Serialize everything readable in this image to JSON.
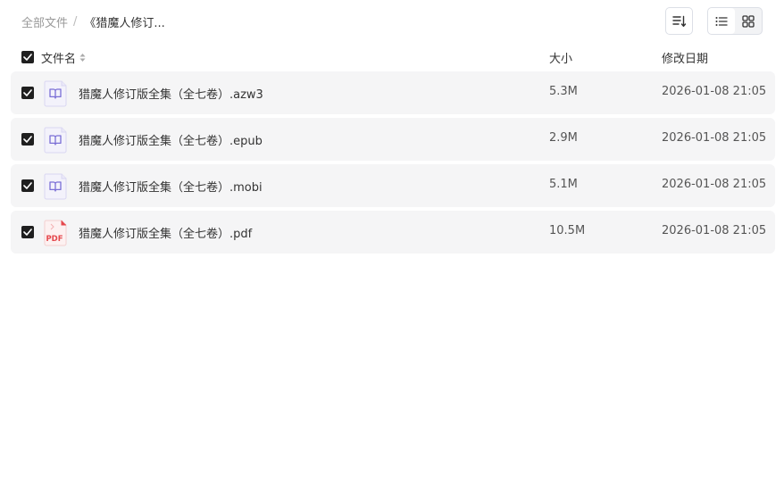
{
  "breadcrumb": {
    "root": "全部文件",
    "separator": "/",
    "current": "《猎魔人修订..."
  },
  "toolbar": {
    "sort_icon": "sort-icon",
    "list_view_icon": "list-view-icon",
    "grid_view_icon": "grid-view-icon"
  },
  "table": {
    "columns": {
      "name": "文件名",
      "size": "大小",
      "modified": "修改日期"
    },
    "select_all_checked": true,
    "files": [
      {
        "name": "猎魔人修订版全集（全七卷）.azw3",
        "size": "5.3M",
        "modified": "2026-01-08 21:05",
        "type": "ebook",
        "checked": true
      },
      {
        "name": "猎魔人修订版全集（全七卷）.epub",
        "size": "2.9M",
        "modified": "2026-01-08 21:05",
        "type": "ebook",
        "checked": true
      },
      {
        "name": "猎魔人修订版全集（全七卷）.mobi",
        "size": "5.1M",
        "modified": "2026-01-08 21:05",
        "type": "ebook",
        "checked": true
      },
      {
        "name": "猎魔人修订版全集（全七卷）.pdf",
        "size": "10.5M",
        "modified": "2026-01-08 21:05",
        "type": "pdf",
        "checked": true
      }
    ]
  },
  "icons": {
    "pdf_label": "PDF"
  },
  "colors": {
    "ebook_icon": "#7b6fd6",
    "pdf_icon": "#e5484d",
    "row_background": "#f5f5f6",
    "checkbox": "#1f1f1f"
  }
}
